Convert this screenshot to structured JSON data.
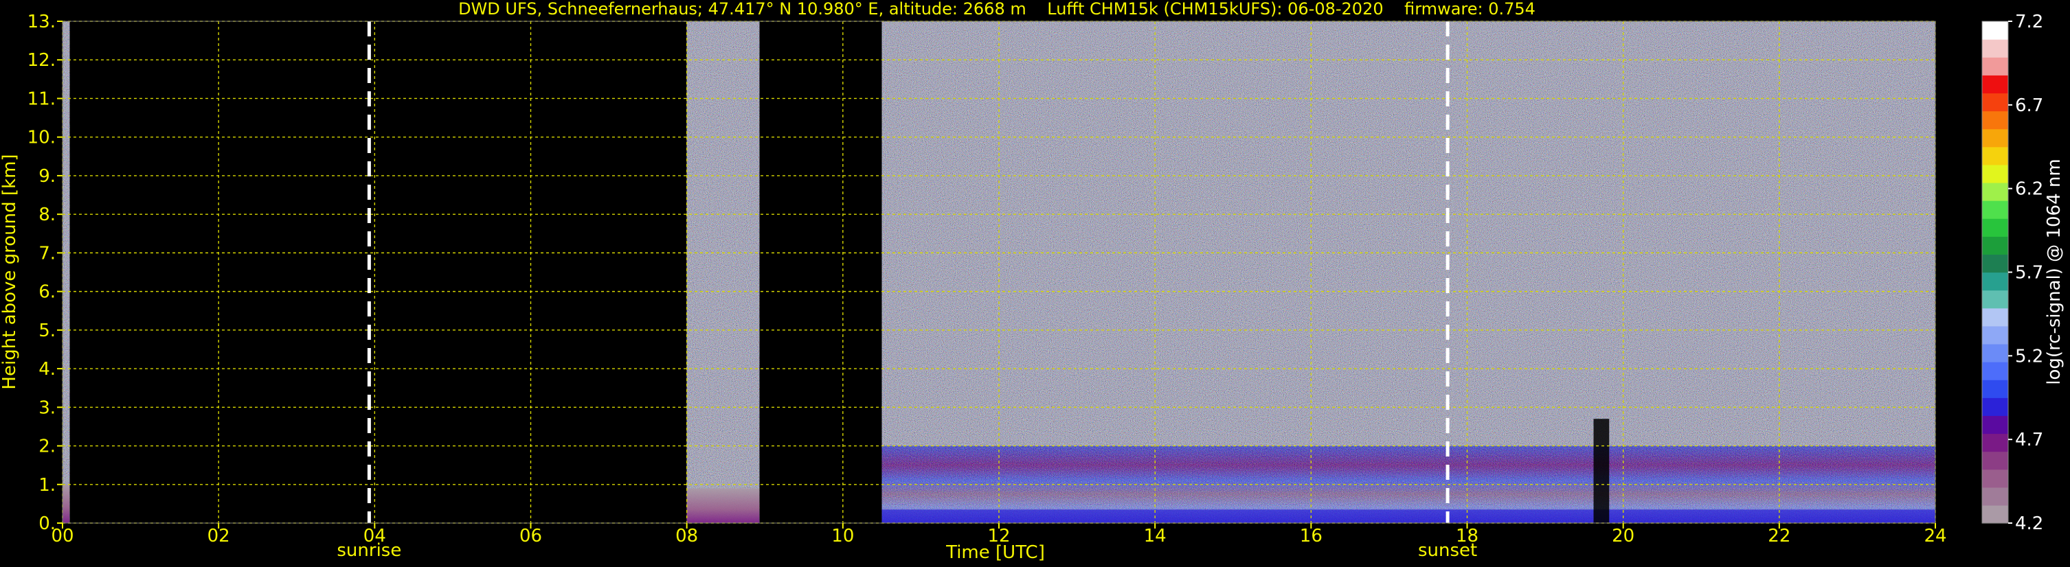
{
  "chart_data": {
    "type": "heatmap",
    "title": "DWD UFS, Schneefernerhaus; 47.417° N 10.980° E, altitude: 2668 m    Lufft CHM15k (CHM15kUFS): 06-08-2020    firmware: 0.754",
    "xlabel": "Time [UTC]",
    "ylabel": "Height above ground [km]",
    "xlim": [
      0,
      24
    ],
    "ylim": [
      0,
      13
    ],
    "x_ticks": [
      "00",
      "02",
      "04",
      "06",
      "08",
      "10",
      "12",
      "14",
      "16",
      "18",
      "20",
      "22",
      "24"
    ],
    "y_ticks": [
      "0.",
      "1.",
      "2.",
      "3.",
      "4.",
      "5.",
      "6.",
      "7.",
      "8.",
      "9.",
      "10.",
      "11.",
      "12.",
      "13."
    ],
    "grid": true,
    "markers": [
      {
        "label": "sunrise",
        "x": 3.93
      },
      {
        "label": "sunset",
        "x": 17.75
      }
    ],
    "data_segments": [
      {
        "start": 0.0,
        "end": 0.09,
        "boundary_layer_top_km": 1.0
      },
      {
        "start": 8.0,
        "end": 8.93,
        "boundary_layer_top_km": 0.9
      },
      {
        "start": 10.5,
        "end": 24.0,
        "boundary_layer_top_km": 2.0
      }
    ],
    "colorbar": {
      "label": "log(rc-signal) @ 1064 nm",
      "min": 4.2,
      "max": 7.2,
      "ticks": [
        "4.2",
        "4.7",
        "5.2",
        "5.7",
        "6.2",
        "6.7",
        "7.2"
      ],
      "colors": [
        "#aa9aa6",
        "#a07c99",
        "#9a5e8d",
        "#8c3d85",
        "#7a1a86",
        "#5a0aa0",
        "#2b22d8",
        "#2f4bef",
        "#4d6dfa",
        "#6b8bf7",
        "#8ea8f6",
        "#b2c6f4",
        "#5fbfb1",
        "#27a08f",
        "#1d7f52",
        "#1c9e3a",
        "#28c43c",
        "#4fe04c",
        "#9ff04a",
        "#e1f51d",
        "#f5d20d",
        "#f7a60a",
        "#f8760c",
        "#f5410e",
        "#ee0f10",
        "#f19a9a",
        "#f4c8c8",
        "#ffffff"
      ]
    }
  }
}
